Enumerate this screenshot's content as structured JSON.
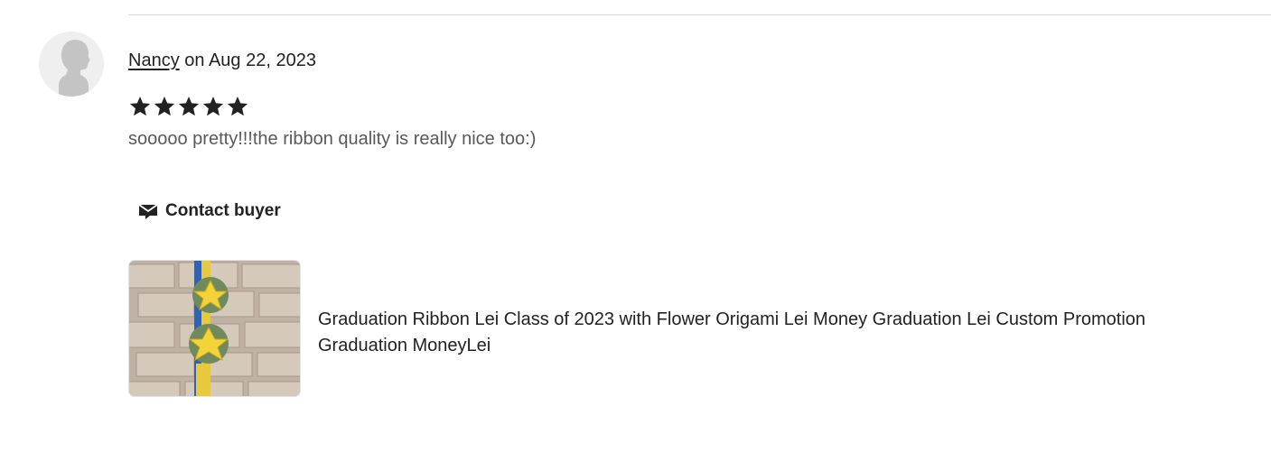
{
  "review": {
    "reviewer_name": "Nancy",
    "date_text": " on Aug 22, 2023",
    "rating": 5,
    "max_rating": 5,
    "text": "sooooo pretty!!!the ribbon quality is really nice too:)"
  },
  "actions": {
    "contact_label": "Contact buyer"
  },
  "listing": {
    "title": "Graduation Ribbon Lei Class of 2023 with Flower Origami Lei Money Graduation Lei Custom Promotion Graduation MoneyLei"
  },
  "icons": {
    "avatar": "default-user-avatar-icon",
    "star": "star-icon",
    "contact": "mail-icon"
  },
  "colors": {
    "text_primary": "#222222",
    "text_secondary": "#595959",
    "divider": "#d6d6d6",
    "avatar_bg": "#efefef",
    "star": "#222222"
  }
}
